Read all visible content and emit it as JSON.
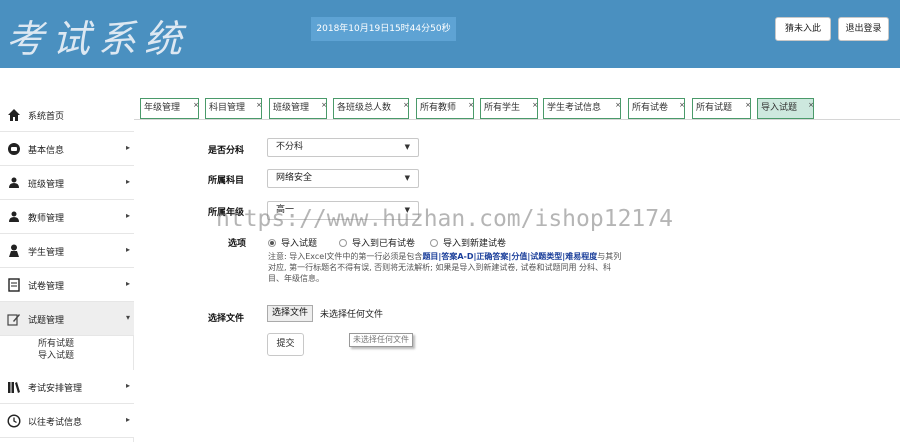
{
  "header": {
    "logo": "考试系统",
    "datetime": "2018年10月19日15时44分50秒",
    "buttons": {
      "guess": "猜未入此",
      "logout": "退出登录"
    }
  },
  "tabs": [
    {
      "label": "年级管理"
    },
    {
      "label": "科目管理"
    },
    {
      "label": "班级管理"
    },
    {
      "label": "各班级总人数"
    },
    {
      "label": "所有教师"
    },
    {
      "label": "所有学生"
    },
    {
      "label": "学生考试信息"
    },
    {
      "label": "所有试卷"
    },
    {
      "label": "所有试题"
    },
    {
      "label": "导入试题"
    }
  ],
  "tab_close": "×",
  "sidebar": {
    "items": [
      {
        "label": "系统首页",
        "icon": "home-icon"
      },
      {
        "label": "基本信息",
        "icon": "info-icon"
      },
      {
        "label": "班级管理",
        "icon": "users-icon"
      },
      {
        "label": "教师管理",
        "icon": "users-icon"
      },
      {
        "label": "学生管理",
        "icon": "user-icon"
      },
      {
        "label": "试卷管理",
        "icon": "document-icon"
      },
      {
        "label": "试题管理",
        "icon": "edit-icon"
      },
      {
        "label": "考试安排管理",
        "icon": "books-icon"
      },
      {
        "label": "以往考试信息",
        "icon": "clock-icon"
      }
    ],
    "sub_items": [
      "所有试题",
      "导入试题"
    ],
    "arrow_right": "▸",
    "arrow_down": "▾"
  },
  "form": {
    "score_label": "是否分科",
    "score_value": "不分科",
    "subject_label": "所属科目",
    "subject_value": "网络安全",
    "grade_label": "所属年级",
    "grade_value": "高一",
    "caret": "▼",
    "options_label": "选项",
    "options": [
      "导入试题",
      "导入到已有试卷",
      "导入到新建试卷"
    ],
    "note_prefix": "注意: 导入Excel文件中的第一行必须是包含",
    "note_bold": "题目|答案A-D|正确答案|分值|试题类型|难易程度",
    "note_suffix": "与其列对应, 第一行标题名不得有误, 否则将无法解析; 如果是导入到新建试卷, 试卷和试题同用 分科、科目、年级信息。",
    "file_label": "选择文件",
    "file_button": "选择文件",
    "file_status": "未选择任何文件",
    "file_tooltip": "未选择任何文件",
    "submit": "提交"
  },
  "watermark": "https://www.huzhan.com/ishop12174",
  "colors": {
    "header": "#4a90c0",
    "tab_border": "#4a9a6a",
    "active_tab": "#cde8de"
  }
}
